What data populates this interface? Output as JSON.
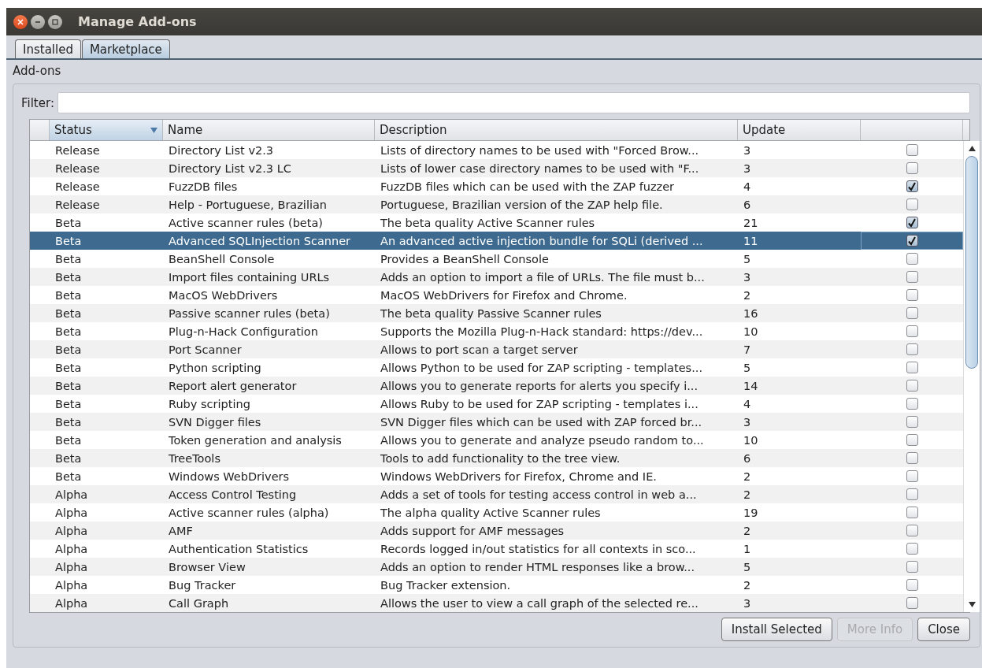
{
  "window": {
    "title": "Manage Add-ons"
  },
  "tabs": [
    {
      "label": "Installed",
      "selected": false
    },
    {
      "label": "Marketplace",
      "selected": true
    }
  ],
  "section_label": "Add-ons",
  "filter": {
    "label": "Filter:"
  },
  "table": {
    "columns": [
      "Status",
      "Name",
      "Description",
      "Update"
    ],
    "rows": [
      {
        "status": "Release",
        "name": "Directory List v2.3",
        "description": "Lists of directory names to be used with \"Forced Brow...",
        "update": "3",
        "checked": false,
        "selected": false
      },
      {
        "status": "Release",
        "name": "Directory List v2.3 LC",
        "description": "Lists of lower case directory names to be used with \"F...",
        "update": "3",
        "checked": false,
        "selected": false
      },
      {
        "status": "Release",
        "name": "FuzzDB files",
        "description": "FuzzDB files which can be used with the ZAP fuzzer",
        "update": "4",
        "checked": true,
        "selected": false
      },
      {
        "status": "Release",
        "name": "Help - Portuguese, Brazilian",
        "description": "Portuguese, Brazilian version of the ZAP help file.",
        "update": "6",
        "checked": false,
        "selected": false
      },
      {
        "status": "Beta",
        "name": "Active scanner rules (beta)",
        "description": "The beta quality Active Scanner rules",
        "update": "21",
        "checked": true,
        "selected": false
      },
      {
        "status": "Beta",
        "name": "Advanced SQLInjection Scanner",
        "description": "An advanced active injection bundle for SQLi (derived ...",
        "update": "11",
        "checked": true,
        "selected": true
      },
      {
        "status": "Beta",
        "name": "BeanShell Console",
        "description": "Provides a BeanShell Console",
        "update": "5",
        "checked": false,
        "selected": false
      },
      {
        "status": "Beta",
        "name": "Import files containing URLs",
        "description": "Adds an option to import a file of URLs. The file must b...",
        "update": "3",
        "checked": false,
        "selected": false
      },
      {
        "status": "Beta",
        "name": "MacOS WebDrivers",
        "description": "MacOS WebDrivers for Firefox and Chrome.",
        "update": "2",
        "checked": false,
        "selected": false
      },
      {
        "status": "Beta",
        "name": "Passive scanner rules (beta)",
        "description": "The beta quality Passive Scanner rules",
        "update": "16",
        "checked": false,
        "selected": false
      },
      {
        "status": "Beta",
        "name": "Plug-n-Hack Configuration",
        "description": "Supports the Mozilla Plug-n-Hack standard: https://dev...",
        "update": "10",
        "checked": false,
        "selected": false
      },
      {
        "status": "Beta",
        "name": "Port Scanner",
        "description": "Allows to port scan a target server",
        "update": "7",
        "checked": false,
        "selected": false
      },
      {
        "status": "Beta",
        "name": "Python scripting",
        "description": "Allows Python to be used for ZAP scripting - templates...",
        "update": "5",
        "checked": false,
        "selected": false
      },
      {
        "status": "Beta",
        "name": "Report alert generator",
        "description": "Allows you to generate reports for alerts you specify i...",
        "update": "14",
        "checked": false,
        "selected": false
      },
      {
        "status": "Beta",
        "name": "Ruby scripting",
        "description": "Allows Ruby to be used for ZAP scripting - templates i...",
        "update": "4",
        "checked": false,
        "selected": false
      },
      {
        "status": "Beta",
        "name": "SVN Digger files",
        "description": "SVN Digger files which can be used with ZAP forced br...",
        "update": "3",
        "checked": false,
        "selected": false
      },
      {
        "status": "Beta",
        "name": "Token generation and analysis",
        "description": "Allows you to generate and analyze pseudo random to...",
        "update": "10",
        "checked": false,
        "selected": false
      },
      {
        "status": "Beta",
        "name": "TreeTools",
        "description": "Tools to add functionality to the tree view.",
        "update": "6",
        "checked": false,
        "selected": false
      },
      {
        "status": "Beta",
        "name": "Windows WebDrivers",
        "description": "Windows WebDrivers for Firefox, Chrome and IE.",
        "update": "2",
        "checked": false,
        "selected": false
      },
      {
        "status": "Alpha",
        "name": "Access Control Testing",
        "description": "Adds a set of tools for testing access control in web a...",
        "update": "2",
        "checked": false,
        "selected": false
      },
      {
        "status": "Alpha",
        "name": "Active scanner rules (alpha)",
        "description": "The alpha quality Active Scanner rules",
        "update": "19",
        "checked": false,
        "selected": false
      },
      {
        "status": "Alpha",
        "name": "AMF",
        "description": "Adds support for AMF messages",
        "update": "2",
        "checked": false,
        "selected": false
      },
      {
        "status": "Alpha",
        "name": "Authentication Statistics",
        "description": "Records logged in/out statistics for all contexts in sco...",
        "update": "1",
        "checked": false,
        "selected": false
      },
      {
        "status": "Alpha",
        "name": "Browser View",
        "description": "Adds an option to render HTML responses like a brow...",
        "update": "5",
        "checked": false,
        "selected": false
      },
      {
        "status": "Alpha",
        "name": "Bug Tracker",
        "description": "Bug Tracker extension.",
        "update": "2",
        "checked": false,
        "selected": false
      },
      {
        "status": "Alpha",
        "name": "Call Graph",
        "description": "Allows the user to view a call graph of the selected re...",
        "update": "3",
        "checked": false,
        "selected": false
      }
    ]
  },
  "buttons": [
    {
      "label": "Install Selected",
      "disabled": false
    },
    {
      "label": "More Info",
      "disabled": true
    },
    {
      "label": "Close",
      "disabled": false
    }
  ]
}
